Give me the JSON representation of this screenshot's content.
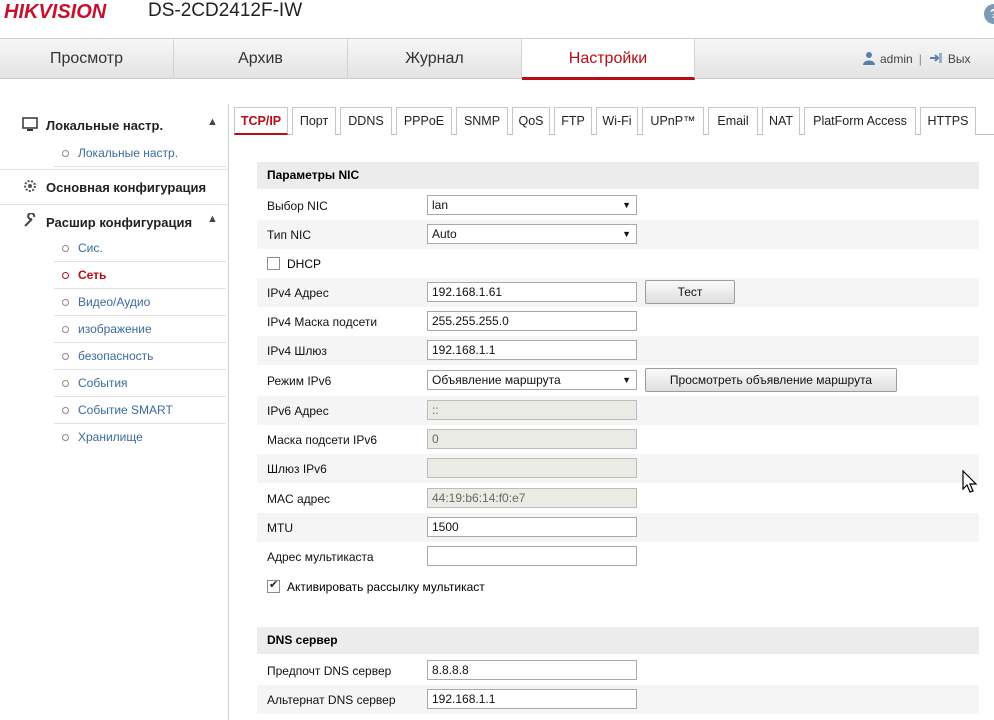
{
  "header": {
    "brand": "HIKVISION",
    "model": "DS-2CD2412F-IW",
    "help_icon": "?"
  },
  "nav": {
    "tabs": [
      "Просмотр",
      "Архив",
      "Журнал",
      "Настройки"
    ],
    "active": "Настройки",
    "user": "admin",
    "separator": "|",
    "logout": "Вых"
  },
  "sidebar": {
    "local_group": "Локальные настр.",
    "local_items": [
      "Локальные настр."
    ],
    "basic_group": "Основная конфигурация",
    "advanced_group": "Расшир конфигурация",
    "advanced_items": [
      "Сис.",
      "Сеть",
      "Видео/Аудио",
      "изображение",
      "безопасность",
      "События",
      "Событие SMART",
      "Хранилище"
    ],
    "active_item": "Сеть"
  },
  "subtabs": [
    "TCP/IP",
    "Порт",
    "DDNS",
    "PPPoE",
    "SNMP",
    "QoS",
    "FTP",
    "Wi-Fi",
    "UPnP™",
    "Email",
    "NAT",
    "PlatForm Access",
    "HTTPS"
  ],
  "nic": {
    "title": "Параметры NIC",
    "nic_select_label": "Выбор NIC",
    "nic_select_value": "lan",
    "nic_type_label": "Тип NIC",
    "nic_type_value": "Auto",
    "dhcp_label": "DHCP",
    "dhcp_checked": false,
    "ipv4_addr_label": "IPv4 Адрес",
    "ipv4_addr": "192.168.1.61",
    "test_button": "Тест",
    "ipv4_mask_label": "IPv4 Маска подсети",
    "ipv4_mask": "255.255.255.0",
    "ipv4_gw_label": "IPv4 Шлюз",
    "ipv4_gw": "192.168.1.1",
    "ipv6_mode_label": "Режим IPv6",
    "ipv6_mode": "Объявление маршрута",
    "view_route_button": "Просмотреть объявление маршрута",
    "ipv6_addr_label": "IPv6 Адрес",
    "ipv6_addr": "::",
    "ipv6_mask_label": "Маска подсети IPv6",
    "ipv6_mask": "0",
    "ipv6_gw_label": "Шлюз IPv6",
    "ipv6_gw": "",
    "mac_label": "MAC адрес",
    "mac": "44:19:b6:14:f0:e7",
    "mtu_label": "MTU",
    "mtu": "1500",
    "multicast_label": "Адрес мультикаста",
    "multicast": "",
    "multicast_enable_label": "Активировать рассылку мультикаст",
    "multicast_enable_checked": true
  },
  "dns": {
    "title": "DNS сервер",
    "pref_label": "Предпочт DNS сервер",
    "pref": "8.8.8.8",
    "alt_label": "Альтернат DNS сервер",
    "alt": "192.168.1.1"
  },
  "colors": {
    "accent": "#b80d16",
    "brand": "#c8102e",
    "link": "#3a6aa0"
  }
}
